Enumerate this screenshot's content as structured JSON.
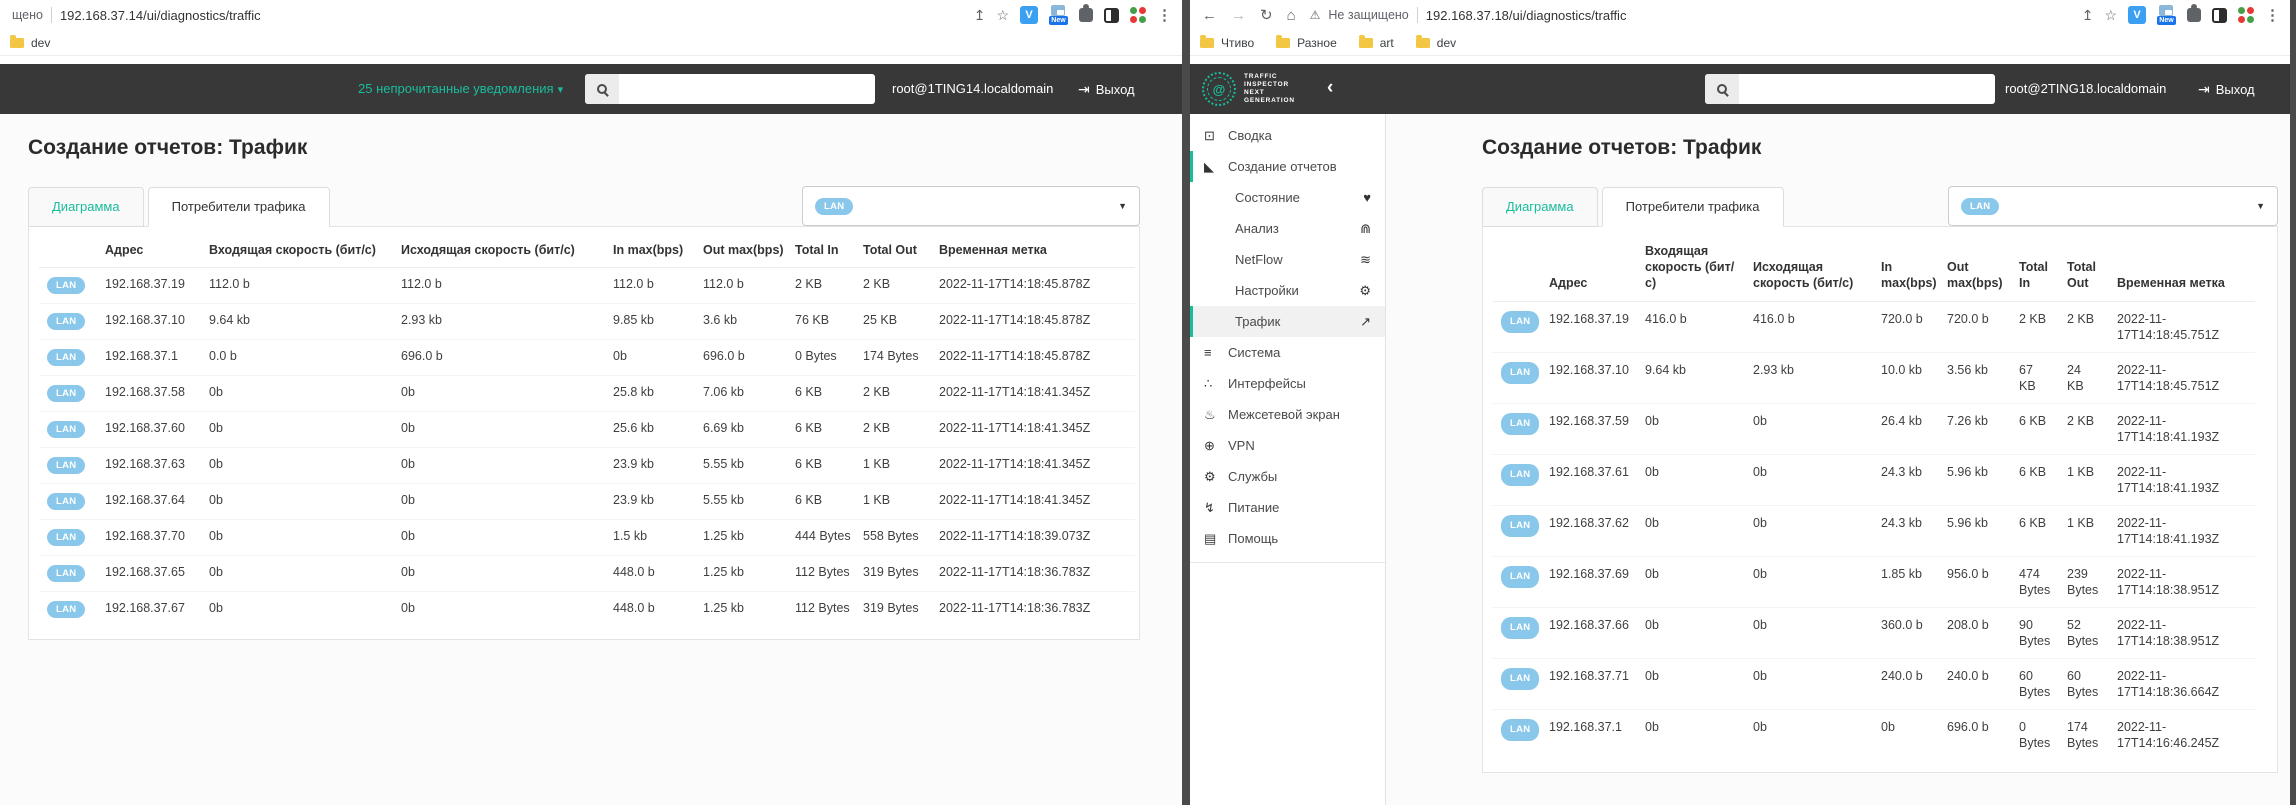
{
  "accent_color": "#1abc9c",
  "lan_badge_color": "#89c8ea",
  "header_bg_color": "#383838",
  "left_window": {
    "chrome": {
      "security_fragment": "щено",
      "url": "192.168.37.14/ui/diagnostics/traffic",
      "extension_v": "V",
      "extension_new": "New",
      "bookmarks": [
        {
          "label": "dev"
        }
      ]
    },
    "header": {
      "notifications": "25 непрочитанные уведомления",
      "user": "root@1TING14.localdomain",
      "logout": "Выход"
    },
    "page": {
      "title": "Создание отчетов: Трафик",
      "tabs": [
        {
          "label": "Диаграмма"
        },
        {
          "label": "Потребители трафика"
        }
      ],
      "interface_filter": "LAN",
      "table": {
        "headers": [
          "Адрес",
          "Входящая скорость (бит/с)",
          "Исходящая скорость (бит/с)",
          "In max(bps)",
          "Out max(bps)",
          "Total In",
          "Total Out",
          "Временная метка"
        ],
        "rows": [
          {
            "badge": "LAN",
            "address": "192.168.37.19",
            "rate_in": "112.0 b",
            "rate_out": "112.0 b",
            "max_in": "112.0 b",
            "max_out": "112.0 b",
            "total_in": "2 KB",
            "total_out": "2 KB",
            "timestamp": "2022-11-17T14:18:45.878Z"
          },
          {
            "badge": "LAN",
            "address": "192.168.37.10",
            "rate_in": "9.64 kb",
            "rate_out": "2.93 kb",
            "max_in": "9.85 kb",
            "max_out": "3.6 kb",
            "total_in": "76 KB",
            "total_out": "25 KB",
            "timestamp": "2022-11-17T14:18:45.878Z"
          },
          {
            "badge": "LAN",
            "address": "192.168.37.1",
            "rate_in": "0.0 b",
            "rate_out": "696.0 b",
            "max_in": "0b",
            "max_out": "696.0 b",
            "total_in": "0 Bytes",
            "total_out": "174 Bytes",
            "timestamp": "2022-11-17T14:18:45.878Z"
          },
          {
            "badge": "LAN",
            "address": "192.168.37.58",
            "rate_in": "0b",
            "rate_out": "0b",
            "max_in": "25.8 kb",
            "max_out": "7.06 kb",
            "total_in": "6 KB",
            "total_out": "2 KB",
            "timestamp": "2022-11-17T14:18:41.345Z"
          },
          {
            "badge": "LAN",
            "address": "192.168.37.60",
            "rate_in": "0b",
            "rate_out": "0b",
            "max_in": "25.6 kb",
            "max_out": "6.69 kb",
            "total_in": "6 KB",
            "total_out": "2 KB",
            "timestamp": "2022-11-17T14:18:41.345Z"
          },
          {
            "badge": "LAN",
            "address": "192.168.37.63",
            "rate_in": "0b",
            "rate_out": "0b",
            "max_in": "23.9 kb",
            "max_out": "5.55 kb",
            "total_in": "6 KB",
            "total_out": "1 KB",
            "timestamp": "2022-11-17T14:18:41.345Z"
          },
          {
            "badge": "LAN",
            "address": "192.168.37.64",
            "rate_in": "0b",
            "rate_out": "0b",
            "max_in": "23.9 kb",
            "max_out": "5.55 kb",
            "total_in": "6 KB",
            "total_out": "1 KB",
            "timestamp": "2022-11-17T14:18:41.345Z"
          },
          {
            "badge": "LAN",
            "address": "192.168.37.70",
            "rate_in": "0b",
            "rate_out": "0b",
            "max_in": "1.5 kb",
            "max_out": "1.25 kb",
            "total_in": "444 Bytes",
            "total_out": "558 Bytes",
            "timestamp": "2022-11-17T14:18:39.073Z"
          },
          {
            "badge": "LAN",
            "address": "192.168.37.65",
            "rate_in": "0b",
            "rate_out": "0b",
            "max_in": "448.0 b",
            "max_out": "1.25 kb",
            "total_in": "112 Bytes",
            "total_out": "319 Bytes",
            "timestamp": "2022-11-17T14:18:36.783Z"
          },
          {
            "badge": "LAN",
            "address": "192.168.37.67",
            "rate_in": "0b",
            "rate_out": "0b",
            "max_in": "448.0 b",
            "max_out": "1.25 kb",
            "total_in": "112 Bytes",
            "total_out": "319 Bytes",
            "timestamp": "2022-11-17T14:18:36.783Z"
          }
        ]
      }
    }
  },
  "right_window": {
    "chrome": {
      "security_text": "Не защищено",
      "url": "192.168.37.18/ui/diagnostics/traffic",
      "extension_v": "V",
      "extension_new": "New",
      "bookmarks": [
        {
          "label": "Чтиво"
        },
        {
          "label": "Разное"
        },
        {
          "label": "art"
        },
        {
          "label": "dev"
        }
      ]
    },
    "logo": {
      "lines": [
        "TRAFFIC",
        "INSPECTOR",
        "NEXT",
        "GENERATION"
      ]
    },
    "header": {
      "user": "root@2TING18.localdomain",
      "logout": "Выход"
    },
    "sidebar": {
      "items": [
        {
          "label": "Сводка",
          "icon": "laptop-icon"
        },
        {
          "label": "Создание отчетов",
          "icon": "area-chart-icon"
        },
        {
          "label": "Состояние",
          "icon": "heartbeat-icon"
        },
        {
          "label": "Анализ",
          "icon": "binoculars-icon"
        },
        {
          "label": "NetFlow",
          "icon": "rss-icon"
        },
        {
          "label": "Настройки",
          "icon": "gear-icon"
        },
        {
          "label": "Трафик",
          "icon": "line-chart-icon"
        },
        {
          "label": "Система",
          "icon": "server-icon"
        },
        {
          "label": "Интерфейсы",
          "icon": "sitemap-icon"
        },
        {
          "label": "Межсетевой экран",
          "icon": "fire-icon"
        },
        {
          "label": "VPN",
          "icon": "globe-icon"
        },
        {
          "label": "Службы",
          "icon": "gear-icon"
        },
        {
          "label": "Питание",
          "icon": "plug-icon"
        },
        {
          "label": "Помощь",
          "icon": "book-icon"
        }
      ]
    },
    "page": {
      "title": "Создание отчетов: Трафик",
      "tabs": [
        {
          "label": "Диаграмма"
        },
        {
          "label": "Потребители трафика"
        }
      ],
      "interface_filter": "LAN",
      "table": {
        "headers": [
          "Адрес",
          "Входящая скорость (бит/с)",
          "Исходящая скорость (бит/с)",
          "In max(bps)",
          "Out max(bps)",
          "Total In",
          "Total Out",
          "Временная метка"
        ],
        "rows": [
          {
            "badge": "LAN",
            "address": "192.168.37.19",
            "rate_in": "416.0 b",
            "rate_out": "416.0 b",
            "max_in": "720.0 b",
            "max_out": "720.0 b",
            "total_in": "2 KB",
            "total_out": "2 KB",
            "timestamp": "2022-11-17T14:18:45.751Z"
          },
          {
            "badge": "LAN",
            "address": "192.168.37.10",
            "rate_in": "9.64 kb",
            "rate_out": "2.93 kb",
            "max_in": "10.0 kb",
            "max_out": "3.56 kb",
            "total_in": "67 KB",
            "total_out": "24 KB",
            "timestamp": "2022-11-17T14:18:45.751Z"
          },
          {
            "badge": "LAN",
            "address": "192.168.37.59",
            "rate_in": "0b",
            "rate_out": "0b",
            "max_in": "26.4 kb",
            "max_out": "7.26 kb",
            "total_in": "6 KB",
            "total_out": "2 KB",
            "timestamp": "2022-11-17T14:18:41.193Z"
          },
          {
            "badge": "LAN",
            "address": "192.168.37.61",
            "rate_in": "0b",
            "rate_out": "0b",
            "max_in": "24.3 kb",
            "max_out": "5.96 kb",
            "total_in": "6 KB",
            "total_out": "1 KB",
            "timestamp": "2022-11-17T14:18:41.193Z"
          },
          {
            "badge": "LAN",
            "address": "192.168.37.62",
            "rate_in": "0b",
            "rate_out": "0b",
            "max_in": "24.3 kb",
            "max_out": "5.96 kb",
            "total_in": "6 KB",
            "total_out": "1 KB",
            "timestamp": "2022-11-17T14:18:41.193Z"
          },
          {
            "badge": "LAN",
            "address": "192.168.37.69",
            "rate_in": "0b",
            "rate_out": "0b",
            "max_in": "1.85 kb",
            "max_out": "956.0 b",
            "total_in": "474 Bytes",
            "total_out": "239 Bytes",
            "timestamp": "2022-11-17T14:18:38.951Z"
          },
          {
            "badge": "LAN",
            "address": "192.168.37.66",
            "rate_in": "0b",
            "rate_out": "0b",
            "max_in": "360.0 b",
            "max_out": "208.0 b",
            "total_in": "90 Bytes",
            "total_out": "52 Bytes",
            "timestamp": "2022-11-17T14:18:38.951Z"
          },
          {
            "badge": "LAN",
            "address": "192.168.37.71",
            "rate_in": "0b",
            "rate_out": "0b",
            "max_in": "240.0 b",
            "max_out": "240.0 b",
            "total_in": "60 Bytes",
            "total_out": "60 Bytes",
            "timestamp": "2022-11-17T14:18:36.664Z"
          },
          {
            "badge": "LAN",
            "address": "192.168.37.1",
            "rate_in": "0b",
            "rate_out": "0b",
            "max_in": "0b",
            "max_out": "696.0 b",
            "total_in": "0 Bytes",
            "total_out": "174 Bytes",
            "timestamp": "2022-11-17T14:16:46.245Z"
          }
        ]
      }
    }
  }
}
